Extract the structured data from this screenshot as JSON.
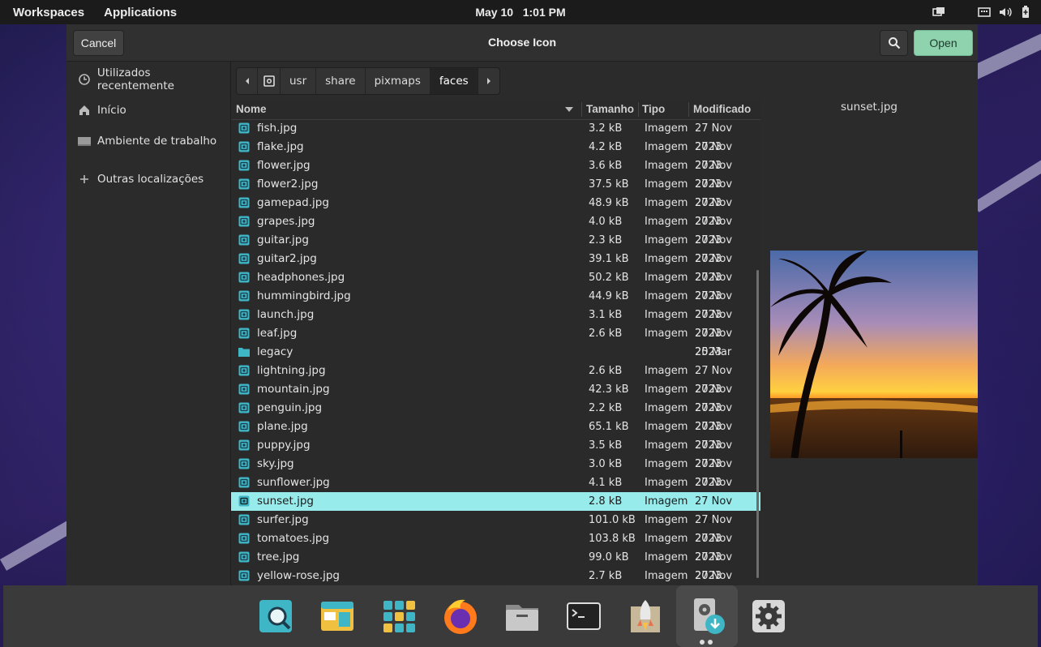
{
  "topbar": {
    "workspaces": "Workspaces",
    "applications": "Applications",
    "date": "May 10",
    "time": "1:01 PM"
  },
  "dialog": {
    "title": "Choose Icon",
    "cancel_label": "Cancel",
    "open_label": "Open",
    "accent": "#98ebeb",
    "open_color": "#8fd3ae"
  },
  "sidebar": {
    "items": [
      {
        "label": "Utilizados recentemente",
        "icon": "recent-icon"
      },
      {
        "label": "Início",
        "icon": "home-icon"
      },
      {
        "label": "Ambiente de trabalho",
        "icon": "desktop-icon"
      },
      {
        "label": "Outras localizações",
        "icon": "plus-icon"
      }
    ]
  },
  "breadcrumbs": [
    "usr",
    "share",
    "pixmaps",
    "faces"
  ],
  "columns": {
    "name": "Nome",
    "size": "Tamanho",
    "type": "Tipo",
    "modified": "Modificado"
  },
  "files": [
    {
      "name": "fish.jpg",
      "size": "3.2 kB",
      "type": "Imagem",
      "modified": "27 Nov 2023"
    },
    {
      "name": "flake.jpg",
      "size": "4.2 kB",
      "type": "Imagem",
      "modified": "27 Nov 2023"
    },
    {
      "name": "flower.jpg",
      "size": "3.6 kB",
      "type": "Imagem",
      "modified": "27 Nov 2023"
    },
    {
      "name": "flower2.jpg",
      "size": "37.5 kB",
      "type": "Imagem",
      "modified": "27 Nov 2023"
    },
    {
      "name": "gamepad.jpg",
      "size": "48.9 kB",
      "type": "Imagem",
      "modified": "27 Nov 2023"
    },
    {
      "name": "grapes.jpg",
      "size": "4.0 kB",
      "type": "Imagem",
      "modified": "27 Nov 2023"
    },
    {
      "name": "guitar.jpg",
      "size": "2.3 kB",
      "type": "Imagem",
      "modified": "27 Nov 2023"
    },
    {
      "name": "guitar2.jpg",
      "size": "39.1 kB",
      "type": "Imagem",
      "modified": "27 Nov 2023"
    },
    {
      "name": "headphones.jpg",
      "size": "50.2 kB",
      "type": "Imagem",
      "modified": "27 Nov 2023"
    },
    {
      "name": "hummingbird.jpg",
      "size": "44.9 kB",
      "type": "Imagem",
      "modified": "27 Nov 2023"
    },
    {
      "name": "launch.jpg",
      "size": "3.1 kB",
      "type": "Imagem",
      "modified": "27 Nov 2023"
    },
    {
      "name": "leaf.jpg",
      "size": "2.6 kB",
      "type": "Imagem",
      "modified": "27 Nov 2023"
    },
    {
      "name": "legacy",
      "size": "",
      "type": "",
      "modified": "25 Mar",
      "folder": true
    },
    {
      "name": "lightning.jpg",
      "size": "2.6 kB",
      "type": "Imagem",
      "modified": "27 Nov 2023"
    },
    {
      "name": "mountain.jpg",
      "size": "42.3 kB",
      "type": "Imagem",
      "modified": "27 Nov 2023"
    },
    {
      "name": "penguin.jpg",
      "size": "2.2 kB",
      "type": "Imagem",
      "modified": "27 Nov 2023"
    },
    {
      "name": "plane.jpg",
      "size": "65.1 kB",
      "type": "Imagem",
      "modified": "27 Nov 2023"
    },
    {
      "name": "puppy.jpg",
      "size": "3.5 kB",
      "type": "Imagem",
      "modified": "27 Nov 2023"
    },
    {
      "name": "sky.jpg",
      "size": "3.0 kB",
      "type": "Imagem",
      "modified": "27 Nov 2023"
    },
    {
      "name": "sunflower.jpg",
      "size": "4.1 kB",
      "type": "Imagem",
      "modified": "27 Nov 2023"
    },
    {
      "name": "sunset.jpg",
      "size": "2.8 kB",
      "type": "Imagem",
      "modified": "27 Nov 2023",
      "selected": true
    },
    {
      "name": "surfer.jpg",
      "size": "101.0 kB",
      "type": "Imagem",
      "modified": "27 Nov 2023"
    },
    {
      "name": "tomatoes.jpg",
      "size": "103.8 kB",
      "type": "Imagem",
      "modified": "27 Nov 2023"
    },
    {
      "name": "tree.jpg",
      "size": "99.0 kB",
      "type": "Imagem",
      "modified": "27 Nov 2023"
    },
    {
      "name": "yellow-rose.jpg",
      "size": "2.7 kB",
      "type": "Imagem",
      "modified": "27 Nov 2023"
    }
  ],
  "preview": {
    "filename": "sunset.jpg"
  },
  "dock": {
    "apps": [
      "search-app-icon",
      "app-center-icon",
      "app-grid-icon",
      "firefox-icon",
      "files-icon",
      "terminal-icon",
      "pop-shop-icon",
      "disk-installer-icon",
      "settings-icon"
    ]
  }
}
